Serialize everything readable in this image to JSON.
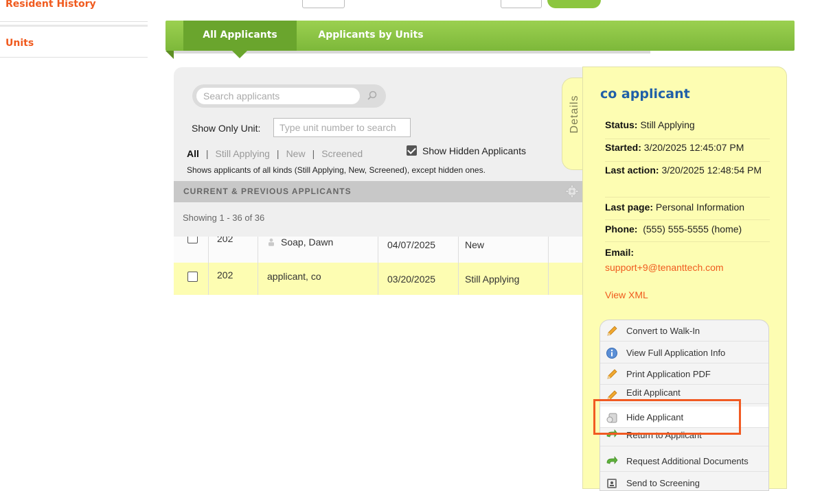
{
  "sidebar": {
    "items": [
      {
        "label": "Resident History"
      },
      {
        "label": "Units"
      }
    ]
  },
  "tabs": [
    {
      "label": "All Applicants",
      "active": true
    },
    {
      "label": "Applicants by Units",
      "active": false
    }
  ],
  "search": {
    "placeholder": "Search applicants"
  },
  "unit_filter": {
    "label": "Show Only Unit:",
    "placeholder": "Type unit number to search"
  },
  "filters": [
    {
      "label": "All",
      "active": true
    },
    {
      "label": "Still Applying",
      "active": false
    },
    {
      "label": "New",
      "active": false
    },
    {
      "label": "Screened",
      "active": false
    }
  ],
  "show_hidden": {
    "label": "Show Hidden Applicants",
    "checked": true
  },
  "filter_description": "Shows applicants of all kinds (Still Applying, New, Screened), except hidden ones.",
  "section_title": "CURRENT & PREVIOUS APPLICANTS",
  "showing_text": "Showing 1 - 36 of 36",
  "rows": [
    {
      "unit": "202",
      "name": "Soap, Dawn",
      "date": "04/07/2025",
      "status": "New",
      "has_icon": true
    },
    {
      "unit": "202",
      "name": "applicant, co",
      "date": "03/20/2025",
      "status": "Still Applying",
      "has_icon": false
    }
  ],
  "details_tab": {
    "label": "Details"
  },
  "details": {
    "name": "co applicant",
    "status_label": "Status:",
    "status": "Still Applying",
    "started_label": "Started:",
    "started": "3/20/2025 12:45:07 PM",
    "last_action_label": "Last action:",
    "last_action": "3/20/2025 12:48:54 PM",
    "last_page_label": "Last page:",
    "last_page": "Personal Information",
    "phone_label": "Phone:",
    "phone": "(555) 555-5555 (home)",
    "email_label": "Email:",
    "email": "support+9@tenanttech.com",
    "view_xml": "View XML"
  },
  "actions": [
    {
      "label": "Convert to Walk-In",
      "icon": "pencil-icon"
    },
    {
      "label": "View Full Application Info",
      "icon": "info-icon"
    },
    {
      "label": "Print Application PDF",
      "icon": "pencil-icon"
    },
    {
      "label": "Edit Applicant",
      "icon": "pencil-icon"
    },
    {
      "label": "Hide Applicant",
      "icon": "hide-icon"
    },
    {
      "label": "Return to Applicant",
      "icon": "return-arrow-icon"
    },
    {
      "label": "Request Additional Documents",
      "icon": "return-arrow-icon"
    },
    {
      "label": "Send to Screening",
      "icon": "screening-icon"
    }
  ],
  "colors": {
    "accent_orange": "#f05a1e",
    "tab_green": "#8cc63f",
    "details_yellow": "#fdfdb2",
    "title_blue": "#1f5fa8",
    "highlight": "#f15a22"
  }
}
